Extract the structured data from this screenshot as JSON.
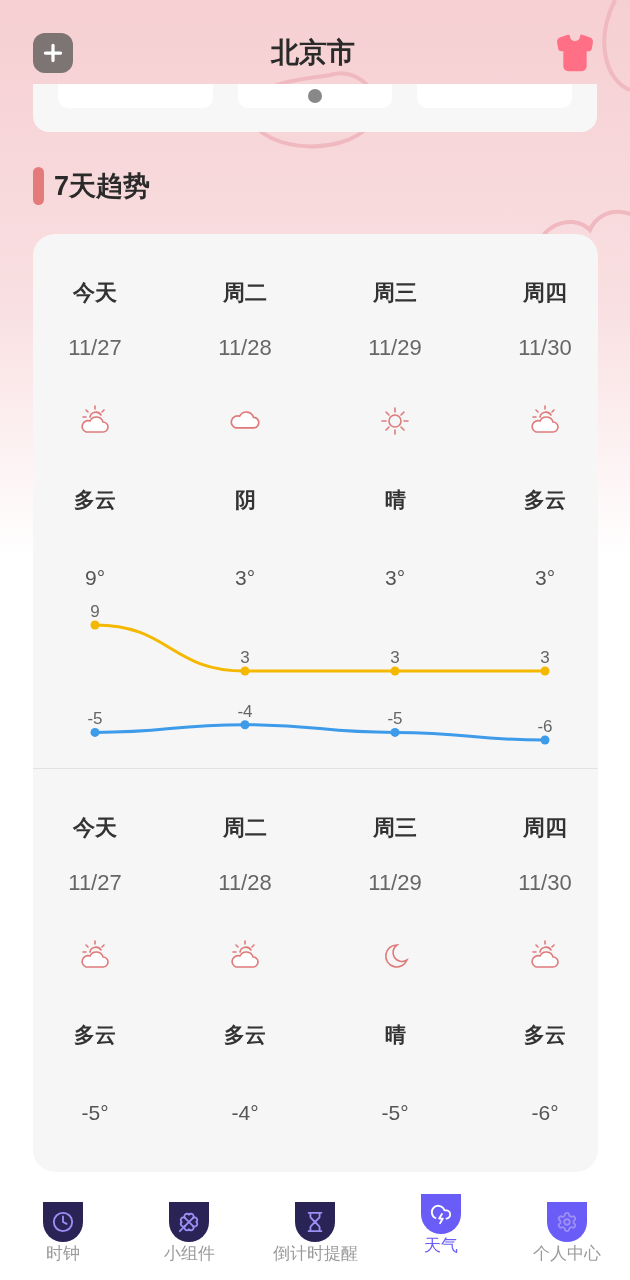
{
  "header": {
    "title": "北京市"
  },
  "section_title": "7天趋势",
  "day_forecast": [
    {
      "day": "今天",
      "date": "11/27",
      "kind": "partly_cloudy",
      "condition": "多云",
      "temp": "9°"
    },
    {
      "day": "周二",
      "date": "11/28",
      "kind": "cloudy",
      "condition": "阴",
      "temp": "3°"
    },
    {
      "day": "周三",
      "date": "11/29",
      "kind": "sunny",
      "condition": "晴",
      "temp": "3°"
    },
    {
      "day": "周四",
      "date": "11/30",
      "kind": "partly_cloudy",
      "condition": "多云",
      "temp": "3°"
    }
  ],
  "chart_data": {
    "type": "line",
    "data_labels": true,
    "series": [
      {
        "color": "#f5b800",
        "marker": "circle",
        "values": [
          9,
          3,
          3,
          3
        ]
      },
      {
        "color": "#3d9be9",
        "marker": "circle",
        "values": [
          -5,
          -4,
          -5,
          -6
        ]
      }
    ]
  },
  "night_forecast": [
    {
      "day": "今天",
      "date": "11/27",
      "kind": "partly_cloudy",
      "condition": "多云",
      "temp": "-5°"
    },
    {
      "day": "周二",
      "date": "11/28",
      "kind": "partly_cloudy",
      "condition": "多云",
      "temp": "-4°"
    },
    {
      "day": "周三",
      "date": "11/29",
      "kind": "moon",
      "condition": "晴",
      "temp": "-5°"
    },
    {
      "day": "周四",
      "date": "11/30",
      "kind": "partly_cloudy",
      "condition": "多云",
      "temp": "-6°"
    }
  ],
  "nav": [
    {
      "label": "时钟",
      "color": "#2a2456",
      "selected": false
    },
    {
      "label": "小组件",
      "color": "#2a2456",
      "selected": false
    },
    {
      "label": "倒计时提醒",
      "color": "#2a2456",
      "selected": false
    },
    {
      "label": "天气",
      "color": "#6a5cf6",
      "selected": true
    },
    {
      "label": "个人中心",
      "color": "#6a5cf6",
      "selected": false
    }
  ]
}
